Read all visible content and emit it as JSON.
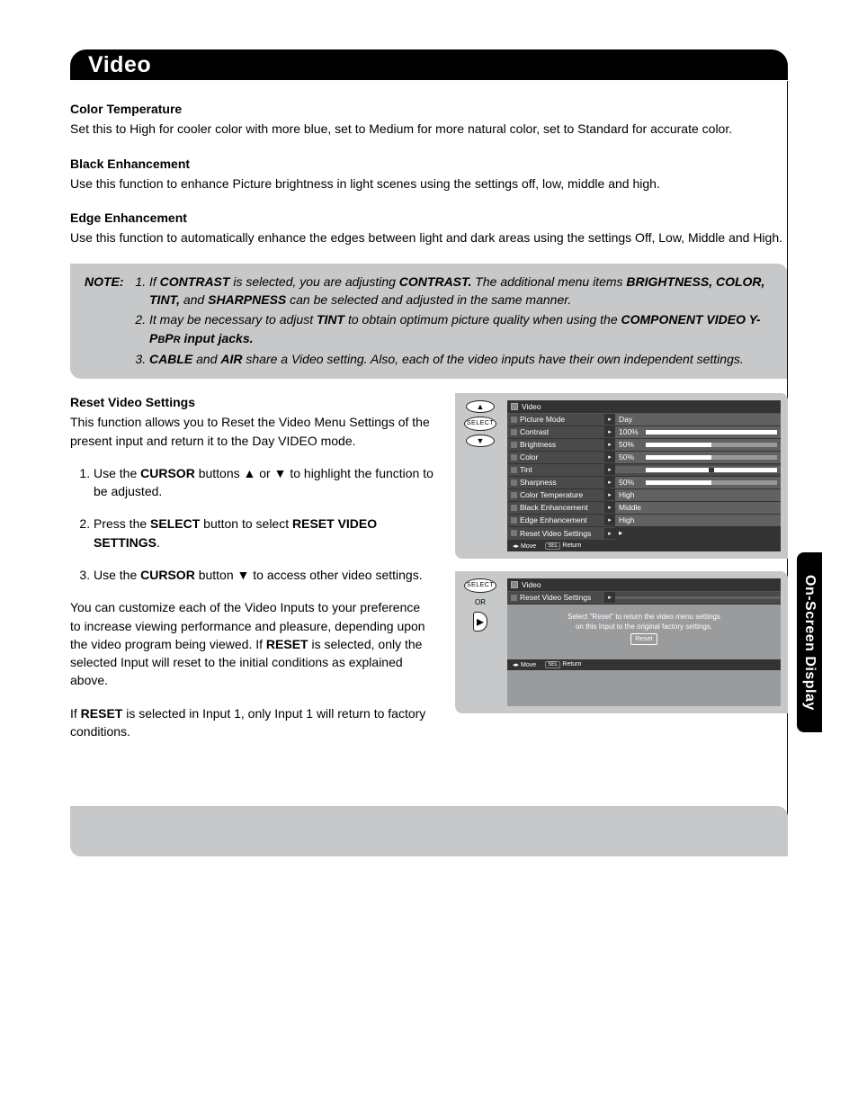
{
  "title": "Video",
  "side_tab": "On-Screen Display",
  "sections": {
    "color_temp": {
      "heading": "Color Temperature",
      "text": "Set this to High for cooler color with more blue, set to Medium for more natural color, set to Standard for accurate color."
    },
    "black_enh": {
      "heading": "Black Enhancement",
      "text": "Use this function to enhance Picture brightness in light scenes using the settings off, low, middle and high."
    },
    "edge_enh": {
      "heading": "Edge Enhancement",
      "text": "Use this function to automatically enhance the edges between light and dark areas using the settings Off, Low, Middle and High."
    }
  },
  "note": {
    "label": "NOTE:",
    "items": [
      {
        "pre": "If ",
        "s1": "CONTRAST",
        "mid1": " is selected, you are adjusting ",
        "s2": "CONTRAST.",
        "mid2": " The additional menu items ",
        "s3": "BRIGHTNESS, COLOR, TINT,",
        "mid3": " and ",
        "s4": "SHARPNESS",
        "post": " can be selected and adjusted in the same manner."
      },
      {
        "pre": "It may be necessary to adjust ",
        "s1": "TINT",
        "mid1": " to obtain optimum picture quality when using the ",
        "s2": "COMPONENT VIDEO Y-P",
        "sc1": "B",
        "s3": "P",
        "sc2": "R",
        "post": " input jacks."
      },
      {
        "s1": "CABLE",
        "mid1": " and ",
        "s2": "AIR",
        "post": " share a Video setting. Also, each of the video inputs have their own independent settings."
      }
    ]
  },
  "reset": {
    "heading": "Reset Video Settings",
    "intro": "This function allows you to Reset the Video Menu Settings of the present input and return it to the Day VIDEO mode.",
    "steps": [
      {
        "pre": "Use the ",
        "b1": "CURSOR",
        "mid": " buttons ▲ or ▼ to highlight the function to be adjusted."
      },
      {
        "pre": "Press the ",
        "b1": "SELECT",
        "mid": " button to select ",
        "b2": "RESET VIDEO SETTINGS",
        "post": "."
      },
      {
        "pre": "Use the ",
        "b1": "CURSOR",
        "mid": " button ▼ to access other video settings."
      }
    ],
    "para1a": "You can customize each of the Video Inputs to your preference to increase viewing performance and pleasure, depending upon the video program being viewed. If ",
    "para1b": "RESET",
    "para1c": " is selected, only the selected Input will reset to the initial conditions as explained above.",
    "para2a": "If ",
    "para2b": "RESET",
    "para2c": " is selected in Input 1, only Input 1 will return to factory conditions."
  },
  "remote": {
    "select": "SELECT",
    "or": "OR"
  },
  "menu1": {
    "header": "Video",
    "rows": [
      {
        "label": "Picture Mode",
        "value": "Day",
        "type": "text"
      },
      {
        "label": "Contrast",
        "value": "100%",
        "type": "slider",
        "fill": 100
      },
      {
        "label": "Brightness",
        "value": "50%",
        "type": "slider",
        "fill": 50
      },
      {
        "label": "Color",
        "value": "50%",
        "type": "slider",
        "fill": 50
      },
      {
        "label": "Tint",
        "value": "",
        "type": "slider-center",
        "fill": 50
      },
      {
        "label": "Sharpness",
        "value": "50%",
        "type": "slider",
        "fill": 50
      },
      {
        "label": "Color Temperature",
        "value": "High",
        "type": "text"
      },
      {
        "label": "Black Enhancement",
        "value": "Middle",
        "type": "text"
      },
      {
        "label": "Edge Enhancement",
        "value": "High",
        "type": "text"
      },
      {
        "label": "Reset Video Settings",
        "value": "",
        "type": "arrow"
      }
    ],
    "footer": {
      "move": "Move",
      "sel": "SEL",
      "ret": "Return"
    }
  },
  "menu2": {
    "header": "Video",
    "row_label": "Reset Video Settings",
    "msg1": "Select \"Reset\" to return the video menu settings",
    "msg2": "on this Input to the original factory settings.",
    "reset": "Reset",
    "footer": {
      "move": "Move",
      "sel": "SEL",
      "ret": "Return"
    }
  }
}
